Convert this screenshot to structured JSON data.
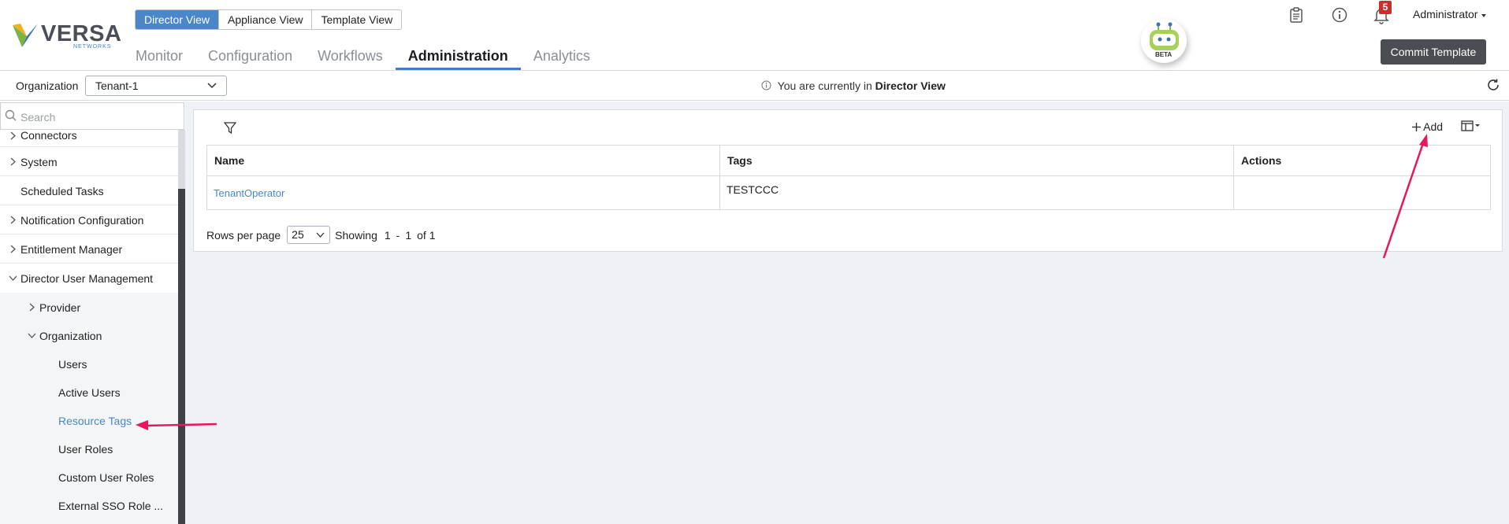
{
  "brand": {
    "name": "VERSA",
    "sub": "NETWORKS"
  },
  "view_switch": {
    "items": [
      "Director View",
      "Appliance View",
      "Template View"
    ],
    "active": "Director View"
  },
  "main_nav": {
    "items": [
      "Monitor",
      "Configuration",
      "Workflows",
      "Administration",
      "Analytics"
    ],
    "active": "Administration"
  },
  "assistant": {
    "badge": "BETA"
  },
  "notifications": {
    "count": "5"
  },
  "user": {
    "label": "Administrator"
  },
  "commit": {
    "label": "Commit Template"
  },
  "org_bar": {
    "label": "Organization",
    "value": "Tenant-1",
    "info_prefix": "You are currently in",
    "info_view": "Director View"
  },
  "sidebar": {
    "search_placeholder": "Search",
    "items": [
      {
        "label": "Connectors"
      },
      {
        "label": "System"
      },
      {
        "label": "Scheduled Tasks"
      },
      {
        "label": "Notification Configuration"
      },
      {
        "label": "Entitlement Manager"
      },
      {
        "label": "Director User Management"
      },
      {
        "label": "Provider"
      },
      {
        "label": "Organization"
      },
      {
        "label": "Users"
      },
      {
        "label": "Active Users"
      },
      {
        "label": "Resource Tags"
      },
      {
        "label": "User Roles"
      },
      {
        "label": "Custom User Roles"
      },
      {
        "label": "External SSO Role ..."
      }
    ]
  },
  "toolbar": {
    "add_label": "Add"
  },
  "table": {
    "columns": [
      "Name",
      "Tags",
      "Actions"
    ],
    "rows": [
      {
        "name": "TenantOperator",
        "tags": "TESTCCC",
        "actions": ""
      }
    ]
  },
  "pagination": {
    "rows_label": "Rows per page",
    "rows_value": "25",
    "showing_label": "Showing",
    "from": "1",
    "sep": "-",
    "to": "1",
    "of_label": "of 1"
  },
  "colors": {
    "accent": "#4a86c8",
    "annotation": "#e8175d",
    "commit_bg": "#4a4d52",
    "badge": "#c9302c"
  }
}
